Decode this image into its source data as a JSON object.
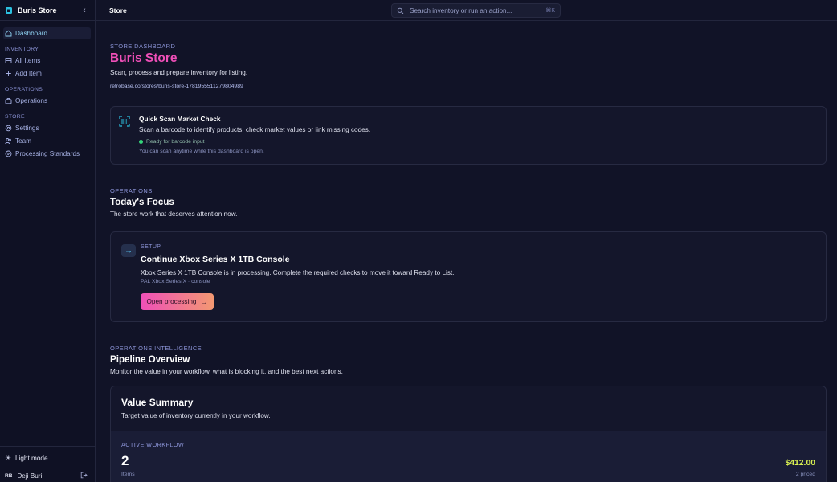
{
  "sidebar": {
    "brand": "Buris Store",
    "items": {
      "dashboard": "Dashboard",
      "all_items": "All Items",
      "add_item": "Add Item",
      "operations": "Operations",
      "settings": "Settings",
      "team": "Team",
      "processing_standards": "Processing Standards"
    },
    "sections": {
      "inventory": "INVENTORY",
      "operations": "OPERATIONS",
      "store": "STORE"
    },
    "light_mode": "Light mode",
    "user": {
      "initials": "RB",
      "name": "Deji Buri"
    }
  },
  "topbar": {
    "title": "Store",
    "search_placeholder": "Search inventory or run an action...",
    "search_shortcut": "⌘K"
  },
  "header": {
    "eyebrow": "STORE DASHBOARD",
    "title": "Buris Store",
    "subtitle": "Scan, process and prepare inventory for listing.",
    "url": "retrobase.co/stores/buris-store-1781955511279804989"
  },
  "scan": {
    "title": "Quick Scan Market Check",
    "description": "Scan a barcode to identify products, check market values or link missing codes.",
    "status": "Ready for barcode input",
    "hint": "You can scan anytime while this dashboard is open."
  },
  "operations": {
    "eyebrow": "OPERATIONS",
    "title": "Today's Focus",
    "subtitle": "The store work that deserves attention now.",
    "focus": {
      "eyebrow": "SETUP",
      "title": "Continue Xbox Series X 1TB Console",
      "description": "Xbox Series X 1TB Console is in processing. Complete the required checks to move it toward Ready to List.",
      "meta": "PAL Xbox Series X · console",
      "button": "Open processing"
    }
  },
  "pipeline": {
    "eyebrow": "OPERATIONS INTELLIGENCE",
    "title": "Pipeline Overview",
    "subtitle": "Monitor the value in your workflow, what is blocking it, and the best next actions.",
    "value_summary": {
      "title": "Value Summary",
      "subtitle": "Target value of inventory currently in your workflow.",
      "active_label": "ACTIVE WORKFLOW",
      "count": "2",
      "count_label": "Items",
      "amount": "$412.00",
      "amount_label": "2 priced"
    }
  },
  "colors": {
    "accent_pink": "#ef4fb8",
    "accent_orange": "#f39872",
    "price_yellow": "#d8ef52",
    "status_green": "#34d67a"
  }
}
